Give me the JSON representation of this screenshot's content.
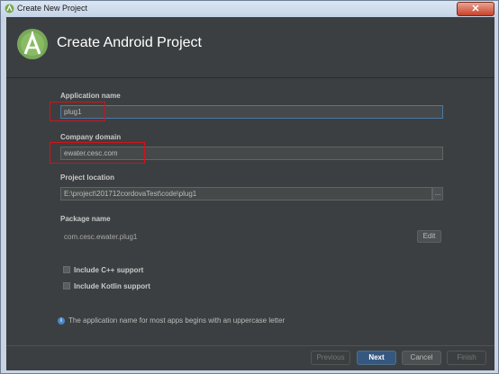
{
  "window": {
    "title": "Create New Project",
    "close_icon": "close-icon"
  },
  "header": {
    "title": "Create Android Project",
    "logo_icon": "android-studio-icon"
  },
  "form": {
    "application_name": {
      "label": "Application name",
      "value": "plug1"
    },
    "company_domain": {
      "label": "Company domain",
      "value": "ewater.cesc.com"
    },
    "project_location": {
      "label": "Project location",
      "value": "E:\\project\\201712cordovaTest\\code\\plug1",
      "browse_label": "..."
    },
    "package_name": {
      "label": "Package name",
      "value": "com.cesc.ewater.plug1",
      "edit_label": "Edit"
    },
    "cpp_support": {
      "label": "Include C++ support",
      "checked": false
    },
    "kotlin_support": {
      "label": "Include Kotlin support",
      "checked": false
    }
  },
  "info": {
    "icon": "info-icon",
    "text": "The application name for most apps begins with an uppercase letter"
  },
  "footer": {
    "previous": "Previous",
    "next": "Next",
    "cancel": "Cancel",
    "finish": "Finish"
  },
  "colors": {
    "header_bg": "#3c3f41",
    "accent": "#365880",
    "highlight_red": "#d0131a"
  }
}
